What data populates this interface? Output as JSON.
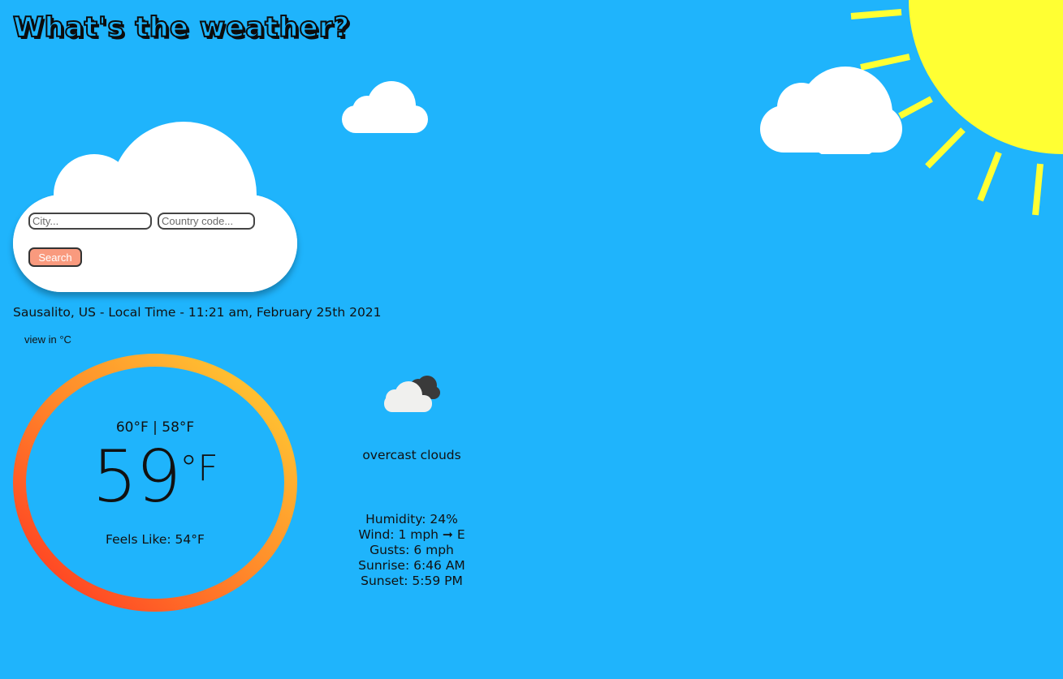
{
  "header": {
    "title": "What's the weather?"
  },
  "search": {
    "city_placeholder": "City...",
    "country_placeholder": "Country code...",
    "button_label": "Search"
  },
  "location_line": "Sausalito, US - Local Time - 11:21 am, February 25th 2021",
  "unit_toggle_label": "view in °C",
  "temperature": {
    "high_low": "60°F | 58°F",
    "current": "59",
    "unit": "°F",
    "feels_like": "Feels Like: 54°F"
  },
  "conditions": {
    "icon": "overcast-clouds-icon",
    "description": "overcast clouds",
    "humidity": "Humidity: 24%",
    "wind": "Wind: 1 mph ➞ E",
    "gusts": "Gusts: 6 mph",
    "sunrise": "Sunrise: 6:46 AM",
    "sunset": "Sunset: 5:59 PM"
  },
  "colors": {
    "background": "#1fb4fc",
    "sun": "#ffff33",
    "button": "#f99a7e",
    "ring_start": "#ff3322",
    "ring_end": "#ffd234"
  }
}
